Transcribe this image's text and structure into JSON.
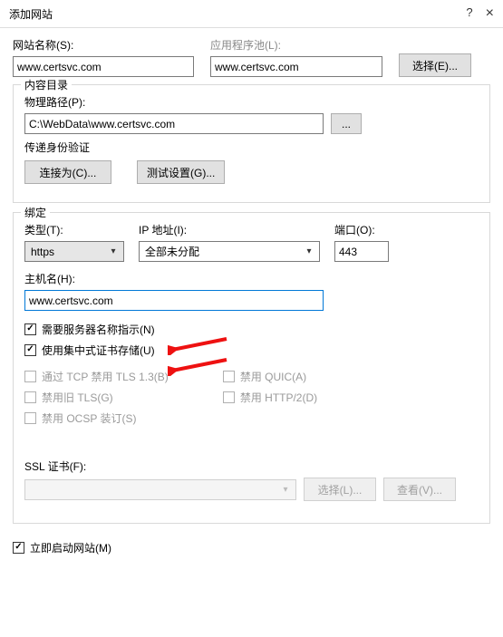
{
  "window": {
    "title": "添加网站",
    "help_icon": "?",
    "close_icon": "×"
  },
  "top": {
    "site_name_label": "网站名称(S):",
    "site_name_value": "www.certsvc.com",
    "app_pool_label": "应用程序池(L):",
    "app_pool_value": "www.certsvc.com",
    "select_btn": "选择(E)..."
  },
  "content_dir": {
    "legend": "内容目录",
    "physical_path_label": "物理路径(P):",
    "physical_path_value": "C:\\WebData\\www.certsvc.com",
    "browse_btn": "...",
    "passthrough_label": "传递身份验证",
    "connect_as_btn": "连接为(C)...",
    "test_settings_btn": "测试设置(G)..."
  },
  "binding": {
    "legend": "绑定",
    "type_label": "类型(T):",
    "type_value": "https",
    "ip_label": "IP 地址(I):",
    "ip_value": "全部未分配",
    "port_label": "端口(O):",
    "port_value": "443",
    "host_label": "主机名(H):",
    "host_value": "www.certsvc.com",
    "cb_sni": "需要服务器名称指示(N)",
    "cb_ccs": "使用集中式证书存储(U)",
    "cb_tls13": "通过 TCP 禁用 TLS 1.3(B)",
    "cb_quic": "禁用 QUIC(A)",
    "cb_oldtls": "禁用旧 TLS(G)",
    "cb_http2": "禁用 HTTP/2(D)",
    "cb_ocsp": "禁用 OCSP 装订(S)",
    "ssl_cert_label": "SSL 证书(F):",
    "ssl_cert_value": "",
    "ssl_select_btn": "选择(L)...",
    "ssl_view_btn": "查看(V)..."
  },
  "footer": {
    "start_site": "立即启动网站(M)"
  }
}
